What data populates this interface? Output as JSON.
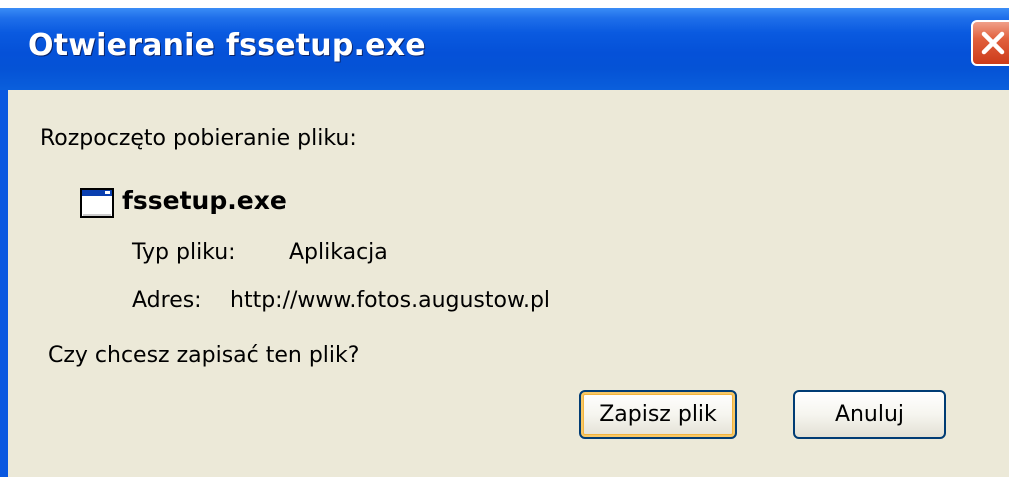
{
  "dialog": {
    "title": "Otwieranie fssetup.exe",
    "intro": "Rozpoczęto pobieranie pliku:",
    "file": {
      "name": "fssetup.exe",
      "icon": "application-window-icon",
      "type_label": "Typ pliku:",
      "type_value": "Aplikacja",
      "address_label": "Adres:",
      "address_value": "http://www.fotos.augustow.pl"
    },
    "question": "Czy chcesz zapisać ten plik?",
    "buttons": {
      "save": "Zapisz plik",
      "cancel": "Anuluj"
    },
    "colors": {
      "titlebar": "#0553d6",
      "body": "#ece9d8",
      "close_button": "#e1603d"
    }
  }
}
